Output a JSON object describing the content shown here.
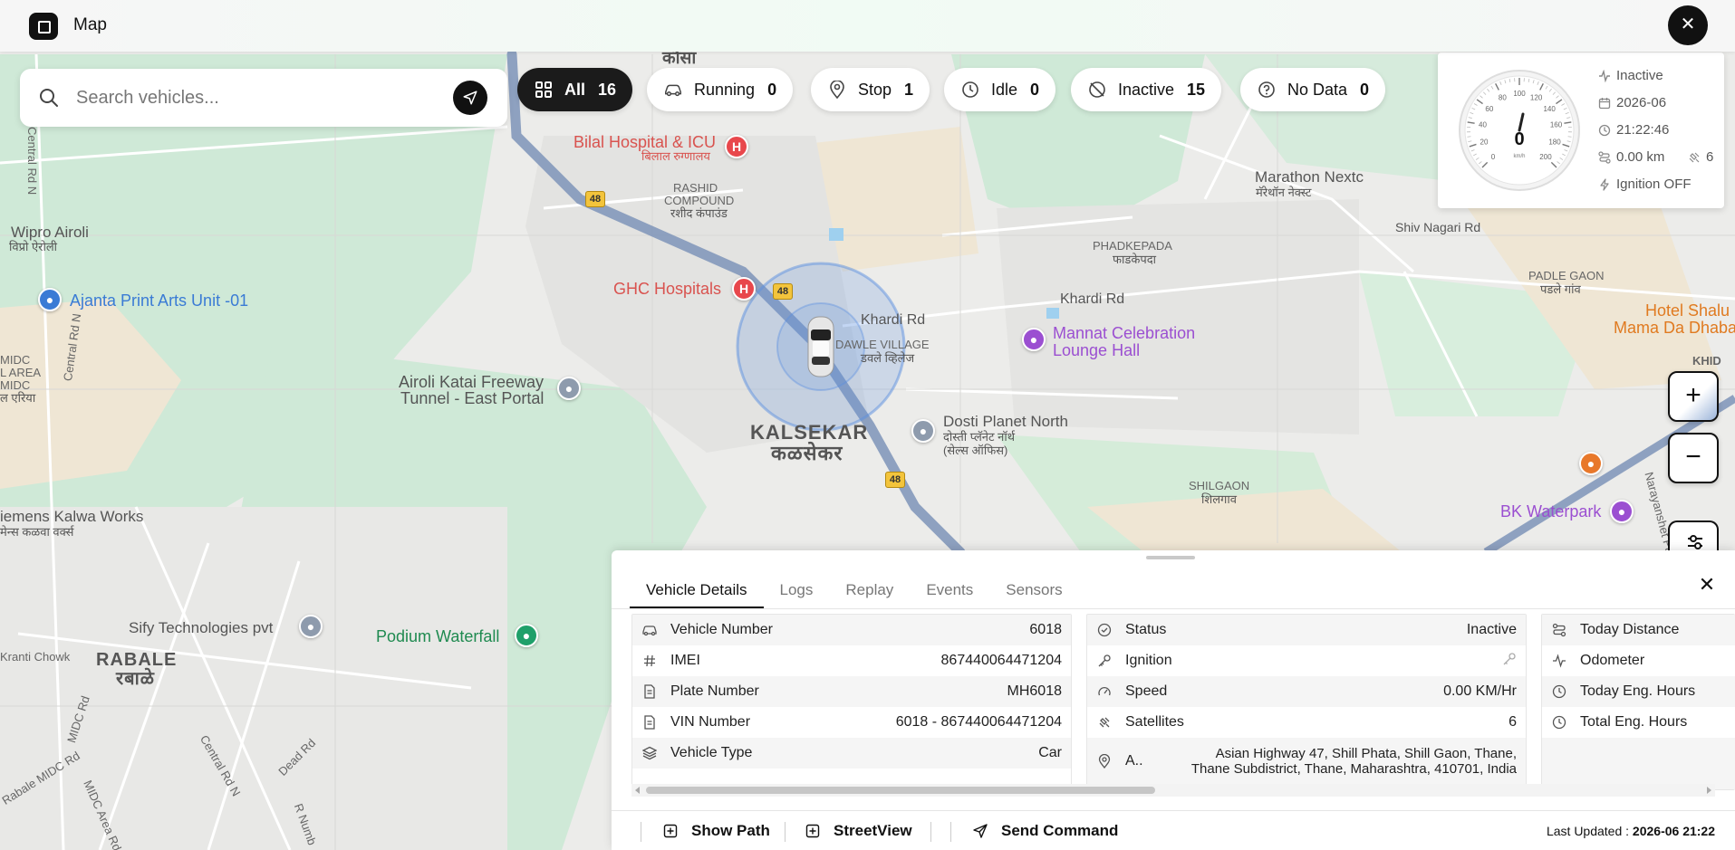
{
  "app": {
    "title": "Map"
  },
  "search": {
    "placeholder": "Search vehicles..."
  },
  "filters": [
    {
      "label": "All",
      "count": "16",
      "icon": "grid-icon"
    },
    {
      "label": "Running",
      "count": "0",
      "icon": "car-icon"
    },
    {
      "label": "Stop",
      "count": "1",
      "icon": "pin-icon"
    },
    {
      "label": "Idle",
      "count": "0",
      "icon": "clock-icon"
    },
    {
      "label": "Inactive",
      "count": "15",
      "icon": "offline-icon"
    },
    {
      "label": "No Data",
      "count": "0",
      "icon": "question-icon"
    }
  ],
  "speedo": {
    "speed": "0",
    "unit": "km/h",
    "ticks": [
      "0",
      "20",
      "40",
      "60",
      "80",
      "100",
      "120",
      "140",
      "160",
      "180",
      "200"
    ],
    "status": "Inactive",
    "date": "2026-06",
    "time": "21:22:46",
    "distance": "0.00 km",
    "satellites": "6",
    "ignition": "Ignition OFF"
  },
  "map": {
    "labels": {
      "kausa": "कौसा",
      "bilal": "Bilal Hospital & ICU",
      "bilal_dev": "बिलाल रुग्णालय",
      "rashid": "RASHID",
      "compound": "COMPOUND",
      "rashid_dev": "रशीद कंपाउंड",
      "ghc": "GHC Hospitals",
      "wipro": "Wipro Airoli",
      "wipro_dev": "विप्रो ऐरोली",
      "ajanta": "Ajanta Print Arts Unit -01",
      "airoli_katai_1": "Airoli Katai Freeway",
      "airoli_katai_2": "Tunnel - East Portal",
      "khardi_rd_1": "Khardi Rd",
      "khardi_rd_2": "Khardi Rd",
      "dawle": "DAWLE VILLAGE",
      "dawle_dev": "डवले व्हिलेज",
      "kalsekar": "KALSEKAR",
      "kalsekar_dev": "कळसेकर",
      "dosti_1": "Dosti Planet North",
      "dosti_dev_1": "दोस्ती प्लॅनेट नॉर्थ",
      "dosti_dev_2": "(सेल्स ऑफिस)",
      "mannat_1": "Mannat Celebration",
      "mannat_2": "Lounge Hall",
      "phadkepada": "PHADKEPADA",
      "phadkepada_dev": "फाडकेपदा",
      "marathon": "Marathon Nextc",
      "marathon_dev": "मॅरेथॉन नेक्स्ट",
      "shiv_nagari": "Shiv Nagari Rd",
      "padle_gaon": "PADLE GAON",
      "padle_gaon_dev": "पडले गांव",
      "hotel_1": "Hotel Shalu",
      "hotel_2": "Mama Da Dhaba",
      "khid": "KHID",
      "shilgaon": "SHILGAON",
      "shilgaon_dev": "शिलगाव",
      "bk_waterpark": "BK Waterpark",
      "narayanshet": "Narayanshet Pa",
      "midc_1": "MIDC",
      "midc_2": "L AREA",
      "midc_3": "MIDC",
      "midc_dev": "ल एरिया",
      "central_rd_1": "Central Rd N",
      "central_rd_2": "Central Rd N",
      "central_rd_3": "Central Rd N",
      "siemens": "iemens Kalwa Works",
      "siemens_dev": "मेन्स कळवा वर्क्स",
      "sify": "Sify Technologies pvt",
      "podium": "Podium Waterfall",
      "rabale": "RABALE",
      "rabale_dev": "रबाळे",
      "kranti": "Kranti Chowk",
      "midc_rd": "MIDC Rd",
      "midc_area_rd": "MIDC Area Rd",
      "dead_rd": "Dead Rd",
      "rabale_midc": "Rabale MIDC Rd",
      "r_num": "R Numb"
    },
    "highway_number": "48"
  },
  "panel": {
    "tabs": [
      "Vehicle Details",
      "Logs",
      "Replay",
      "Events",
      "Sensors"
    ],
    "vehicle": [
      {
        "label": "Vehicle Number",
        "value": "6018",
        "icon": "car-icon"
      },
      {
        "label": "IMEI",
        "value": "867440064471204",
        "icon": "hash-icon"
      },
      {
        "label": "Plate Number",
        "value": "MH6018",
        "icon": "document-icon"
      },
      {
        "label": "VIN Number",
        "value": "6018 - 867440064471204",
        "icon": "document-icon"
      },
      {
        "label": "Vehicle Type",
        "value": "Car",
        "icon": "layers-icon"
      }
    ],
    "status": [
      {
        "label": "Status",
        "value": "Inactive",
        "icon": "check-circle-icon"
      },
      {
        "label": "Ignition",
        "value": "",
        "icon": "key-icon"
      },
      {
        "label": "Speed",
        "value": "0.00 KM/Hr",
        "icon": "gauge-icon"
      },
      {
        "label": "Satellites",
        "value": "6",
        "icon": "satellite-icon"
      }
    ],
    "address": {
      "label": "A..",
      "line1": "Asian Highway 47, Shill Phata, Shill Gaon, Thane,",
      "line2": "Thane Subdistrict, Thane, Maharashtra, 410701, India"
    },
    "metrics": [
      {
        "label": "Today Distance",
        "icon": "route-icon"
      },
      {
        "label": "Odometer",
        "icon": "activity-icon"
      },
      {
        "label": "Today Eng. Hours",
        "icon": "clock-icon"
      },
      {
        "label": "Total Eng. Hours",
        "icon": "clock-icon"
      }
    ],
    "footer": {
      "show_path": "Show Path",
      "street_view": "StreetView",
      "send_command": "Send Command",
      "last_updated_label": "Last Updated :",
      "last_updated_value": "2026-06 21:22"
    }
  },
  "colors": {
    "accent": "#111111",
    "route": "#7e94b8",
    "car_halo": "#5b8fe0",
    "hospital": "#e8474c",
    "park": "#1fa06a"
  }
}
